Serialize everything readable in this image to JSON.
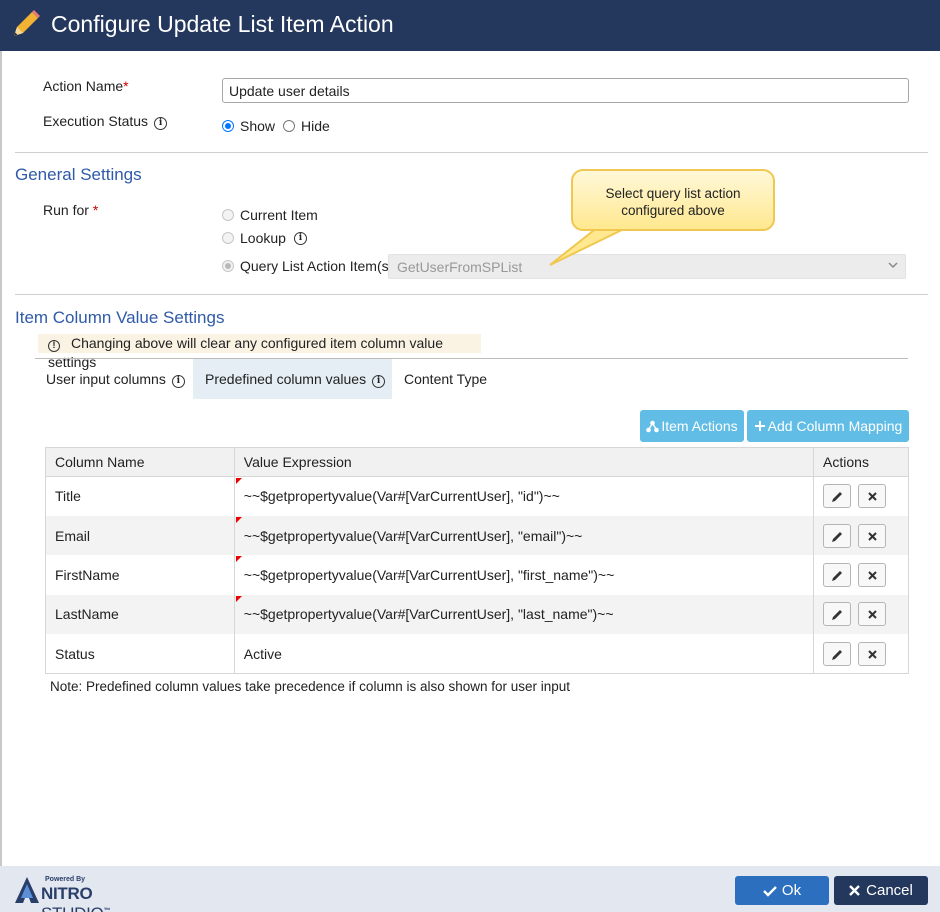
{
  "dialog": {
    "title": "Configure Update List Item Action"
  },
  "action_name": {
    "label": "Action Name",
    "required_mark": "*",
    "value": "Update user details"
  },
  "execution_status": {
    "label": "Execution Status",
    "options": [
      "Show",
      "Hide"
    ],
    "selected": "Show"
  },
  "general_settings": {
    "title": "General Settings",
    "run_for": {
      "label": "Run for",
      "required_mark": "*",
      "options": [
        "Current Item",
        "Lookup",
        "Query List Action Item(s)"
      ],
      "selected": "Query List Action Item(s)"
    },
    "query_select": {
      "value": "GetUserFromSPList"
    },
    "callout": {
      "line1": "Select query list action",
      "line2": "configured above"
    }
  },
  "item_column": {
    "title": "Item Column Value Settings",
    "warning": "Changing above will clear any configured item column value settings",
    "tabs": [
      {
        "label": "User input columns",
        "active": false
      },
      {
        "label": "Predefined column values",
        "active": true
      },
      {
        "label": "Content Type",
        "active": false
      }
    ],
    "buttons": {
      "item_actions": "Item Actions",
      "add_mapping": "Add Column Mapping"
    },
    "table": {
      "headers": [
        "Column Name",
        "Value Expression",
        "Actions"
      ],
      "rows": [
        {
          "column": "Title",
          "expression": "~~$getpropertyvalue(Var#[VarCurrentUser], \"id\")~~"
        },
        {
          "column": "Email",
          "expression": "~~$getpropertyvalue(Var#[VarCurrentUser], \"email\")~~"
        },
        {
          "column": "FirstName",
          "expression": "~~$getpropertyvalue(Var#[VarCurrentUser], \"first_name\")~~"
        },
        {
          "column": "LastName",
          "expression": "~~$getpropertyvalue(Var#[VarCurrentUser], \"last_name\")~~"
        },
        {
          "column": "Status",
          "expression": "Active"
        }
      ]
    },
    "note": "Note: Predefined column values take precedence if column is also shown for user input"
  },
  "footer": {
    "powered_by": "Powered By",
    "brand_bold": "NITRO",
    "brand_rest": "STUDIO",
    "tm": "™",
    "ok_label": "Ok",
    "cancel_label": "Cancel"
  },
  "colors": {
    "title_bar": "#24385d",
    "accent_blue": "#2f5aa8",
    "light_button": "#62bde6",
    "ok_button": "#2c6fbf"
  }
}
